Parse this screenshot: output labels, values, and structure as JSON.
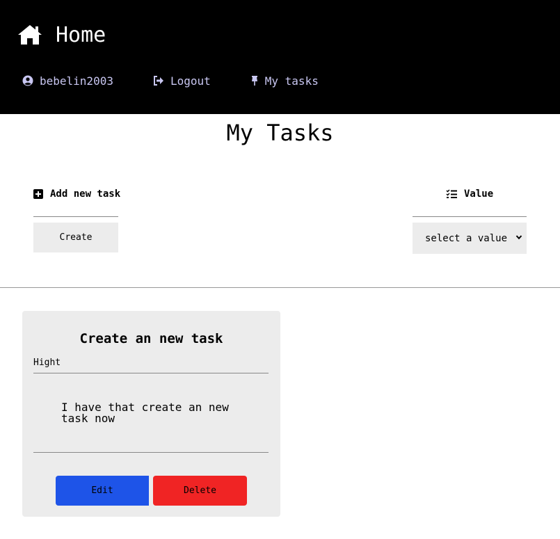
{
  "header": {
    "title": "Home",
    "title_icon": "house-icon",
    "background": "#000000",
    "nav_color": "#c9c7f2",
    "nav": [
      {
        "label": "bebelin2003",
        "icon": "user-circle-icon"
      },
      {
        "label": "Logout",
        "icon": "sign-out-icon"
      },
      {
        "label": "My tasks",
        "icon": "thumbtack-icon"
      }
    ]
  },
  "page": {
    "title": "My Tasks"
  },
  "add_panel": {
    "label": "Add new task",
    "icon": "plus-square-icon",
    "button_label": "Create"
  },
  "value_panel": {
    "label": "Value",
    "icon": "task-list-icon",
    "select_value": "select a value"
  },
  "tasks": [
    {
      "title": "Create an new task",
      "priority": "Hight",
      "description": "I have that create an new task now",
      "edit_label": "Edit",
      "delete_label": "Delete",
      "edit_color": "#1e54e8",
      "delete_color": "#f02424"
    }
  ]
}
